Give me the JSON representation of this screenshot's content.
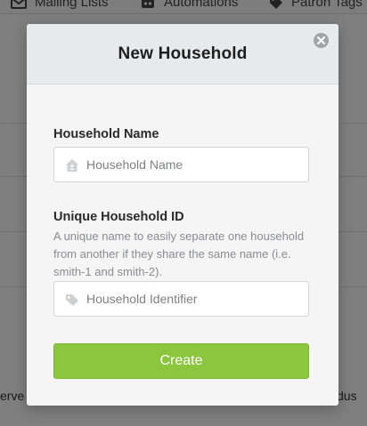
{
  "background": {
    "nav": {
      "items": [
        {
          "label": "Mailing Lists",
          "icon": "mailing-list-icon"
        },
        {
          "label": "Automations",
          "icon": "robot-icon"
        },
        {
          "label": "Patron Tags",
          "icon": "tag-icon"
        }
      ]
    },
    "partial_text_left": "erve",
    "partial_text_right": "dus"
  },
  "modal": {
    "title": "New Household",
    "close_icon": "close-icon",
    "fields": {
      "household_name": {
        "label": "Household Name",
        "placeholder": "Household Name",
        "value": "",
        "icon": "house-icon"
      },
      "household_id": {
        "label": "Unique Household ID",
        "help_text": "A unique name to easily separate one household from another if they share the same name (i.e. smith-1 and smith-2).",
        "placeholder": "Household Identifier",
        "value": "",
        "icon": "tag-icon"
      }
    },
    "submit_label": "Create"
  },
  "colors": {
    "primary_button": "#8cc63f",
    "overlay": "rgba(0,0,0,0.5)",
    "modal_header": "#e8e9ea",
    "modal_body": "#f5f5f6"
  }
}
